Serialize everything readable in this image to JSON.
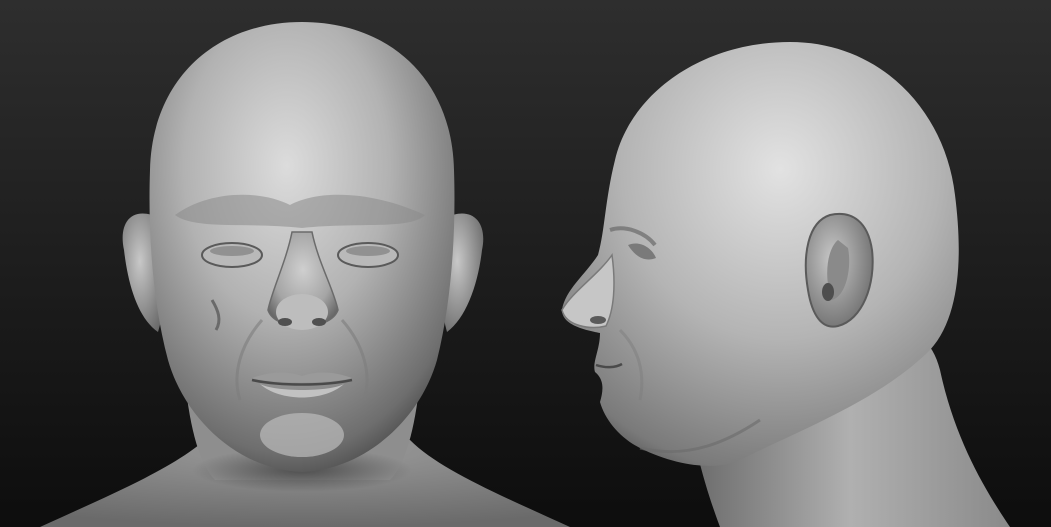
{
  "scene": {
    "background_top": "#2e2e2e",
    "background_bottom": "#0d0d0d",
    "clay_light": "#dedede",
    "clay_mid": "#9a9a9a",
    "clay_dark": "#3a3a3a"
  },
  "views": [
    {
      "view": "front"
    },
    {
      "view": "side"
    }
  ]
}
